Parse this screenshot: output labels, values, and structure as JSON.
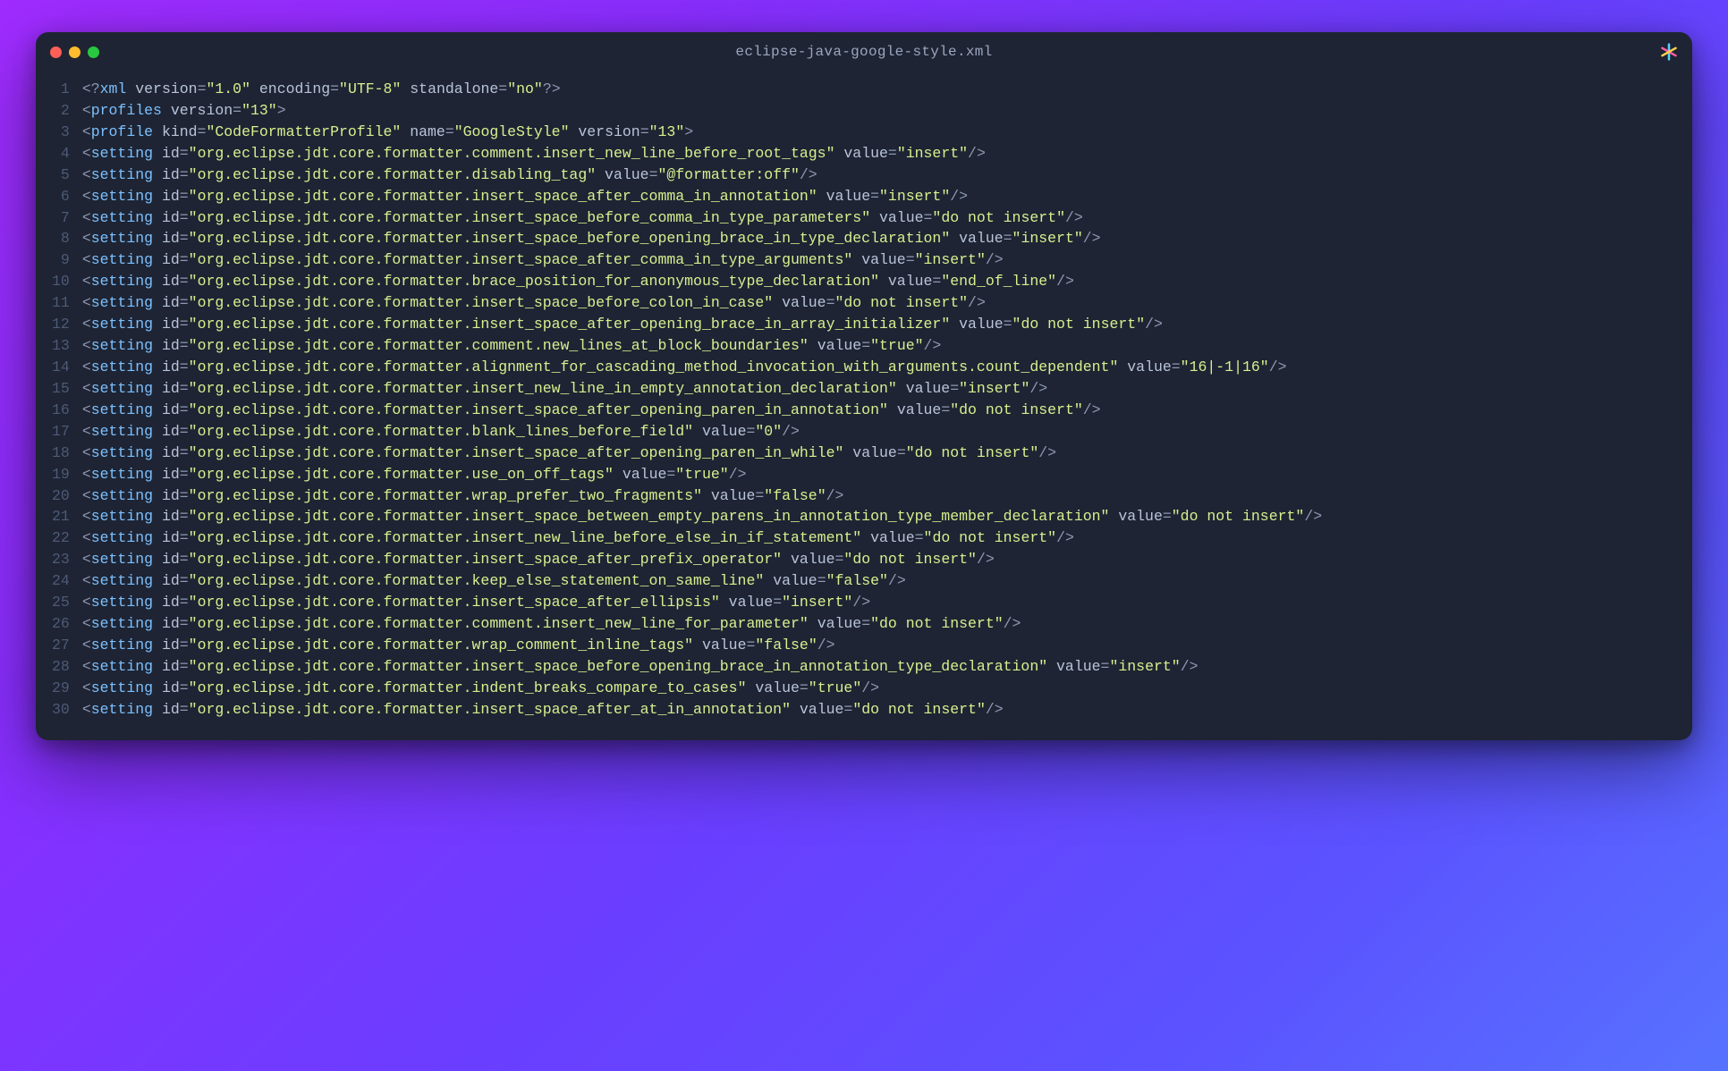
{
  "window": {
    "title": "eclipse-java-google-style.xml"
  },
  "lines": [
    {
      "n": 1,
      "tokens": [
        {
          "c": "t-punc",
          "t": "<?"
        },
        {
          "c": "t-decl",
          "t": "xml"
        },
        {
          "c": "",
          "t": " "
        },
        {
          "c": "t-attr",
          "t": "version"
        },
        {
          "c": "t-punc",
          "t": "="
        },
        {
          "c": "t-quote",
          "t": "\""
        },
        {
          "c": "t-str",
          "t": "1.0"
        },
        {
          "c": "t-quote",
          "t": "\""
        },
        {
          "c": "",
          "t": " "
        },
        {
          "c": "t-attr",
          "t": "encoding"
        },
        {
          "c": "t-punc",
          "t": "="
        },
        {
          "c": "t-quote",
          "t": "\""
        },
        {
          "c": "t-str",
          "t": "UTF-8"
        },
        {
          "c": "t-quote",
          "t": "\""
        },
        {
          "c": "",
          "t": " "
        },
        {
          "c": "t-attr",
          "t": "standalone"
        },
        {
          "c": "t-punc",
          "t": "="
        },
        {
          "c": "t-quote",
          "t": "\""
        },
        {
          "c": "t-str",
          "t": "no"
        },
        {
          "c": "t-quote",
          "t": "\""
        },
        {
          "c": "t-punc",
          "t": "?>"
        }
      ]
    },
    {
      "n": 2,
      "tokens": [
        {
          "c": "t-punc",
          "t": "<"
        },
        {
          "c": "t-tag",
          "t": "profiles"
        },
        {
          "c": "",
          "t": " "
        },
        {
          "c": "t-attr",
          "t": "version"
        },
        {
          "c": "t-punc",
          "t": "="
        },
        {
          "c": "t-quote",
          "t": "\""
        },
        {
          "c": "t-str",
          "t": "13"
        },
        {
          "c": "t-quote",
          "t": "\""
        },
        {
          "c": "t-punc",
          "t": ">"
        }
      ]
    },
    {
      "n": 3,
      "tokens": [
        {
          "c": "t-punc",
          "t": "<"
        },
        {
          "c": "t-tag",
          "t": "profile"
        },
        {
          "c": "",
          "t": " "
        },
        {
          "c": "t-attr",
          "t": "kind"
        },
        {
          "c": "t-punc",
          "t": "="
        },
        {
          "c": "t-quote",
          "t": "\""
        },
        {
          "c": "t-str",
          "t": "CodeFormatterProfile"
        },
        {
          "c": "t-quote",
          "t": "\""
        },
        {
          "c": "",
          "t": " "
        },
        {
          "c": "t-attr",
          "t": "name"
        },
        {
          "c": "t-punc",
          "t": "="
        },
        {
          "c": "t-quote",
          "t": "\""
        },
        {
          "c": "t-str",
          "t": "GoogleStyle"
        },
        {
          "c": "t-quote",
          "t": "\""
        },
        {
          "c": "",
          "t": " "
        },
        {
          "c": "t-attr",
          "t": "version"
        },
        {
          "c": "t-punc",
          "t": "="
        },
        {
          "c": "t-quote",
          "t": "\""
        },
        {
          "c": "t-str",
          "t": "13"
        },
        {
          "c": "t-quote",
          "t": "\""
        },
        {
          "c": "t-punc",
          "t": ">"
        }
      ]
    },
    {
      "n": 4,
      "setting": {
        "id": "org.eclipse.jdt.core.formatter.comment.insert_new_line_before_root_tags",
        "value": "insert"
      }
    },
    {
      "n": 5,
      "setting": {
        "id": "org.eclipse.jdt.core.formatter.disabling_tag",
        "value": "@formatter:off"
      }
    },
    {
      "n": 6,
      "setting": {
        "id": "org.eclipse.jdt.core.formatter.insert_space_after_comma_in_annotation",
        "value": "insert"
      }
    },
    {
      "n": 7,
      "setting": {
        "id": "org.eclipse.jdt.core.formatter.insert_space_before_comma_in_type_parameters",
        "value": "do not insert"
      }
    },
    {
      "n": 8,
      "setting": {
        "id": "org.eclipse.jdt.core.formatter.insert_space_before_opening_brace_in_type_declaration",
        "value": "insert"
      }
    },
    {
      "n": 9,
      "setting": {
        "id": "org.eclipse.jdt.core.formatter.insert_space_after_comma_in_type_arguments",
        "value": "insert"
      }
    },
    {
      "n": 10,
      "setting": {
        "id": "org.eclipse.jdt.core.formatter.brace_position_for_anonymous_type_declaration",
        "value": "end_of_line"
      }
    },
    {
      "n": 11,
      "setting": {
        "id": "org.eclipse.jdt.core.formatter.insert_space_before_colon_in_case",
        "value": "do not insert"
      }
    },
    {
      "n": 12,
      "setting": {
        "id": "org.eclipse.jdt.core.formatter.insert_space_after_opening_brace_in_array_initializer",
        "value": "do not insert"
      }
    },
    {
      "n": 13,
      "setting": {
        "id": "org.eclipse.jdt.core.formatter.comment.new_lines_at_block_boundaries",
        "value": "true"
      }
    },
    {
      "n": 14,
      "setting": {
        "id": "org.eclipse.jdt.core.formatter.alignment_for_cascading_method_invocation_with_arguments.count_dependent",
        "value": "16|-1|16"
      }
    },
    {
      "n": 15,
      "setting": {
        "id": "org.eclipse.jdt.core.formatter.insert_new_line_in_empty_annotation_declaration",
        "value": "insert"
      }
    },
    {
      "n": 16,
      "setting": {
        "id": "org.eclipse.jdt.core.formatter.insert_space_after_opening_paren_in_annotation",
        "value": "do not insert"
      }
    },
    {
      "n": 17,
      "setting": {
        "id": "org.eclipse.jdt.core.formatter.blank_lines_before_field",
        "value": "0"
      }
    },
    {
      "n": 18,
      "setting": {
        "id": "org.eclipse.jdt.core.formatter.insert_space_after_opening_paren_in_while",
        "value": "do not insert"
      }
    },
    {
      "n": 19,
      "setting": {
        "id": "org.eclipse.jdt.core.formatter.use_on_off_tags",
        "value": "true"
      }
    },
    {
      "n": 20,
      "setting": {
        "id": "org.eclipse.jdt.core.formatter.wrap_prefer_two_fragments",
        "value": "false"
      }
    },
    {
      "n": 21,
      "setting": {
        "id": "org.eclipse.jdt.core.formatter.insert_space_between_empty_parens_in_annotation_type_member_declaration",
        "value": "do not insert"
      }
    },
    {
      "n": 22,
      "setting": {
        "id": "org.eclipse.jdt.core.formatter.insert_new_line_before_else_in_if_statement",
        "value": "do not insert"
      }
    },
    {
      "n": 23,
      "setting": {
        "id": "org.eclipse.jdt.core.formatter.insert_space_after_prefix_operator",
        "value": "do not insert"
      }
    },
    {
      "n": 24,
      "setting": {
        "id": "org.eclipse.jdt.core.formatter.keep_else_statement_on_same_line",
        "value": "false"
      }
    },
    {
      "n": 25,
      "setting": {
        "id": "org.eclipse.jdt.core.formatter.insert_space_after_ellipsis",
        "value": "insert"
      }
    },
    {
      "n": 26,
      "setting": {
        "id": "org.eclipse.jdt.core.formatter.comment.insert_new_line_for_parameter",
        "value": "do not insert"
      }
    },
    {
      "n": 27,
      "setting": {
        "id": "org.eclipse.jdt.core.formatter.wrap_comment_inline_tags",
        "value": "false"
      }
    },
    {
      "n": 28,
      "setting": {
        "id": "org.eclipse.jdt.core.formatter.insert_space_before_opening_brace_in_annotation_type_declaration",
        "value": "insert"
      }
    },
    {
      "n": 29,
      "setting": {
        "id": "org.eclipse.jdt.core.formatter.indent_breaks_compare_to_cases",
        "value": "true"
      }
    },
    {
      "n": 30,
      "setting": {
        "id": "org.eclipse.jdt.core.formatter.insert_space_after_at_in_annotation",
        "value": "do not insert"
      }
    }
  ]
}
